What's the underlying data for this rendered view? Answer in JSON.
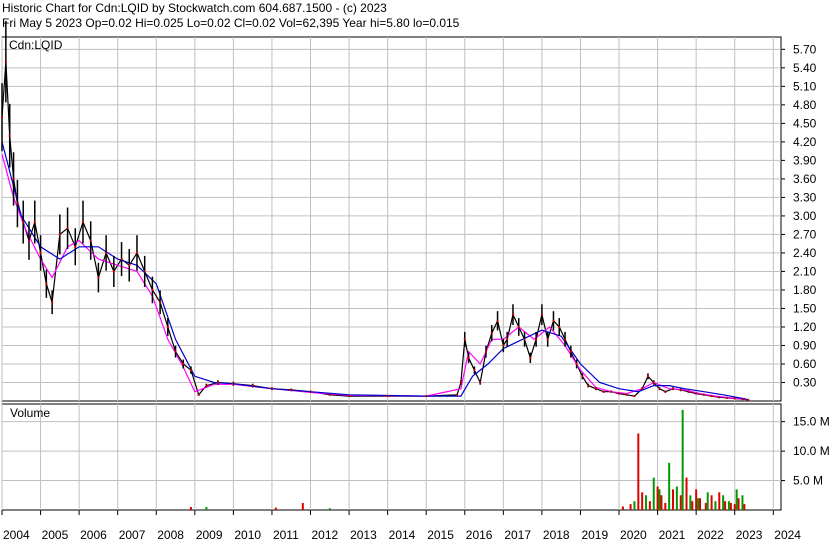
{
  "header": {
    "line1": "Historic Chart for Cdn:LQID by Stockwatch.com 604.687.1500 - (c) 2023",
    "line2": "Fri May  5 2023  Op=0.02  Hi=0.025  Lo=0.02  Cl=0.02  Vol=62,395  Year hi=5.80  lo=0.015"
  },
  "colors": {
    "price": "#000000",
    "ma_short": "#ff00ff",
    "ma_long": "#0000cc",
    "close_marker": "#cc0000",
    "vol_up": "#009900",
    "vol_down": "#dd0000",
    "grid": "#c0c0c0"
  },
  "chart_data": [
    {
      "type": "line",
      "title": "Cdn:LQID",
      "ylim": [
        0,
        5.9
      ],
      "xlim": [
        2004,
        2024.2
      ],
      "grid": true,
      "y_ticks": [
        0.3,
        0.6,
        0.9,
        1.2,
        1.5,
        1.8,
        2.1,
        2.4,
        2.7,
        3.0,
        3.3,
        3.6,
        3.9,
        4.2,
        4.5,
        4.8,
        5.1,
        5.4,
        5.7
      ],
      "y_tick_labels": [
        "0.30",
        "0.60",
        "0.90",
        "1.20",
        "1.50",
        "1.80",
        "2.10",
        "2.40",
        "2.70",
        "3.00",
        "3.30",
        "3.60",
        "3.90",
        "4.20",
        "4.50",
        "4.80",
        "5.10",
        "5.40",
        "5.70"
      ],
      "x_ticks": [
        2004,
        2005,
        2006,
        2007,
        2008,
        2009,
        2010,
        2011,
        2012,
        2013,
        2014,
        2015,
        2016,
        2017,
        2018,
        2019,
        2020,
        2021,
        2022,
        2023,
        2024
      ],
      "x_tick_labels": [
        "2004",
        "2005",
        "2006",
        "2007",
        "2008",
        "2009",
        "2010",
        "2011",
        "2012",
        "2013",
        "2014",
        "2015",
        "2016",
        "2017",
        "2018",
        "2019",
        "2020",
        "2021",
        "2022",
        "2023",
        "2024"
      ],
      "series": [
        {
          "key": "price",
          "x": [
            2004.0,
            2004.1,
            2004.2,
            2004.3,
            2004.4,
            2004.55,
            2004.7,
            2004.85,
            2005.0,
            2005.15,
            2005.3,
            2005.5,
            2005.7,
            2005.9,
            2006.1,
            2006.3,
            2006.5,
            2006.7,
            2006.9,
            2007.1,
            2007.3,
            2007.5,
            2007.7,
            2007.9,
            2008.1,
            2008.3,
            2008.5,
            2008.7,
            2008.9,
            2009.1,
            2009.3,
            2009.6,
            2010.0,
            2010.5,
            2011.0,
            2011.5,
            2012.0,
            2012.5,
            2013.0,
            2014.0,
            2015.0,
            2015.8,
            2015.9,
            2016.0,
            2016.1,
            2016.25,
            2016.4,
            2016.55,
            2016.7,
            2016.85,
            2017.0,
            2017.1,
            2017.25,
            2017.4,
            2017.55,
            2017.7,
            2017.85,
            2018.0,
            2018.15,
            2018.3,
            2018.45,
            2018.6,
            2018.75,
            2018.9,
            2019.05,
            2019.2,
            2019.4,
            2019.6,
            2019.8,
            2020.0,
            2020.2,
            2020.4,
            2020.6,
            2020.75,
            2020.9,
            2021.05,
            2021.2,
            2021.4,
            2021.6,
            2021.8,
            2022.0,
            2022.2,
            2022.4,
            2022.6,
            2022.8,
            2023.0,
            2023.2,
            2023.35
          ],
          "y": [
            4.6,
            5.5,
            4.3,
            3.6,
            3.2,
            2.9,
            2.6,
            2.9,
            2.4,
            1.9,
            1.6,
            2.7,
            2.8,
            2.5,
            2.9,
            2.6,
            2.0,
            2.4,
            2.1,
            2.3,
            2.2,
            2.4,
            2.1,
            1.8,
            1.6,
            1.2,
            0.8,
            0.6,
            0.5,
            0.1,
            0.25,
            0.3,
            0.28,
            0.25,
            0.2,
            0.18,
            0.15,
            0.1,
            0.08,
            0.08,
            0.08,
            0.1,
            0.3,
            1.0,
            0.7,
            0.5,
            0.3,
            0.8,
            1.1,
            1.3,
            0.9,
            1.0,
            1.4,
            1.2,
            1.0,
            0.7,
            1.0,
            1.4,
            1.0,
            1.3,
            1.2,
            1.0,
            0.8,
            0.6,
            0.4,
            0.25,
            0.2,
            0.15,
            0.15,
            0.12,
            0.1,
            0.08,
            0.2,
            0.4,
            0.3,
            0.2,
            0.15,
            0.2,
            0.18,
            0.15,
            0.12,
            0.1,
            0.08,
            0.06,
            0.05,
            0.04,
            0.03,
            0.02
          ]
        },
        {
          "key": "ma_short",
          "x": [
            2004.0,
            2004.3,
            2004.6,
            2005.0,
            2005.3,
            2005.7,
            2006.0,
            2006.5,
            2007.0,
            2007.5,
            2007.9,
            2008.3,
            2008.7,
            2009.0,
            2009.5,
            2010.0,
            2011.0,
            2012.0,
            2013.0,
            2015.0,
            2015.9,
            2016.1,
            2016.4,
            2016.7,
            2017.0,
            2017.4,
            2017.8,
            2018.2,
            2018.6,
            2019.0,
            2019.4,
            2019.8,
            2020.2,
            2020.6,
            2020.9,
            2021.3,
            2021.7,
            2022.1,
            2022.5,
            2022.9,
            2023.3
          ],
          "y": [
            4.0,
            3.3,
            2.8,
            2.3,
            2.0,
            2.5,
            2.6,
            2.3,
            2.2,
            2.1,
            1.7,
            1.0,
            0.55,
            0.15,
            0.27,
            0.27,
            0.2,
            0.14,
            0.09,
            0.08,
            0.2,
            0.8,
            0.6,
            1.0,
            1.0,
            1.2,
            1.0,
            1.2,
            0.9,
            0.5,
            0.22,
            0.15,
            0.12,
            0.2,
            0.3,
            0.2,
            0.18,
            0.12,
            0.08,
            0.05,
            0.025
          ]
        },
        {
          "key": "ma_long",
          "x": [
            2004.0,
            2004.5,
            2005.0,
            2005.5,
            2006.0,
            2006.5,
            2007.0,
            2007.5,
            2008.0,
            2008.5,
            2009.0,
            2009.5,
            2010.0,
            2011.0,
            2012.0,
            2013.0,
            2015.0,
            2015.9,
            2016.2,
            2016.6,
            2017.0,
            2017.5,
            2018.0,
            2018.5,
            2019.0,
            2019.5,
            2020.0,
            2020.5,
            2020.9,
            2021.3,
            2021.7,
            2022.2,
            2022.7,
            2023.3
          ],
          "y": [
            4.2,
            3.0,
            2.5,
            2.3,
            2.5,
            2.5,
            2.3,
            2.2,
            1.9,
            1.0,
            0.4,
            0.3,
            0.28,
            0.2,
            0.15,
            0.1,
            0.08,
            0.08,
            0.4,
            0.6,
            0.85,
            1.0,
            1.15,
            1.05,
            0.6,
            0.3,
            0.2,
            0.15,
            0.25,
            0.25,
            0.2,
            0.15,
            0.1,
            0.03
          ]
        }
      ]
    },
    {
      "type": "bar",
      "title": "Volume",
      "ylim": [
        0,
        18
      ],
      "y_ticks": [
        5.0,
        10.0,
        15.0
      ],
      "y_tick_labels": [
        "5.0 M",
        "10.0 M",
        "15.0 M"
      ],
      "x_ticks": [
        2004,
        2005,
        2006,
        2007,
        2008,
        2009,
        2010,
        2011,
        2012,
        2013,
        2014,
        2015,
        2016,
        2017,
        2018,
        2019,
        2020,
        2021,
        2022,
        2023,
        2024
      ],
      "series": [
        {
          "key": "vol_down",
          "x": [
            2008.9,
            2011.1,
            2011.8,
            2020.1,
            2020.3,
            2020.5,
            2020.6,
            2020.8,
            2021.0,
            2021.1,
            2021.2,
            2021.4,
            2021.6,
            2021.75,
            2021.9,
            2022.0,
            2022.1,
            2022.25,
            2022.4,
            2022.6,
            2022.75,
            2022.9,
            2023.0,
            2023.1,
            2023.25
          ],
          "values": [
            0.5,
            0.4,
            1.2,
            0.6,
            1.0,
            13.0,
            3.0,
            1.5,
            4.0,
            2.5,
            1.2,
            3.5,
            2.5,
            5.5,
            1.5,
            3.5,
            2.0,
            1.2,
            2.5,
            3.0,
            1.5,
            1.2,
            1.0,
            2.0,
            1.0
          ]
        },
        {
          "key": "vol_up",
          "x": [
            2009.3,
            2012.5,
            2020.4,
            2020.7,
            2020.9,
            2021.05,
            2021.3,
            2021.5,
            2021.65,
            2021.85,
            2022.05,
            2022.3,
            2022.5,
            2022.7,
            2022.85,
            2023.05,
            2023.2
          ],
          "values": [
            0.5,
            0.3,
            1.5,
            2.5,
            5.5,
            3.5,
            8.0,
            4.0,
            17.0,
            2.5,
            2.0,
            3.0,
            1.5,
            2.5,
            1.5,
            3.5,
            2.5
          ]
        }
      ]
    }
  ]
}
